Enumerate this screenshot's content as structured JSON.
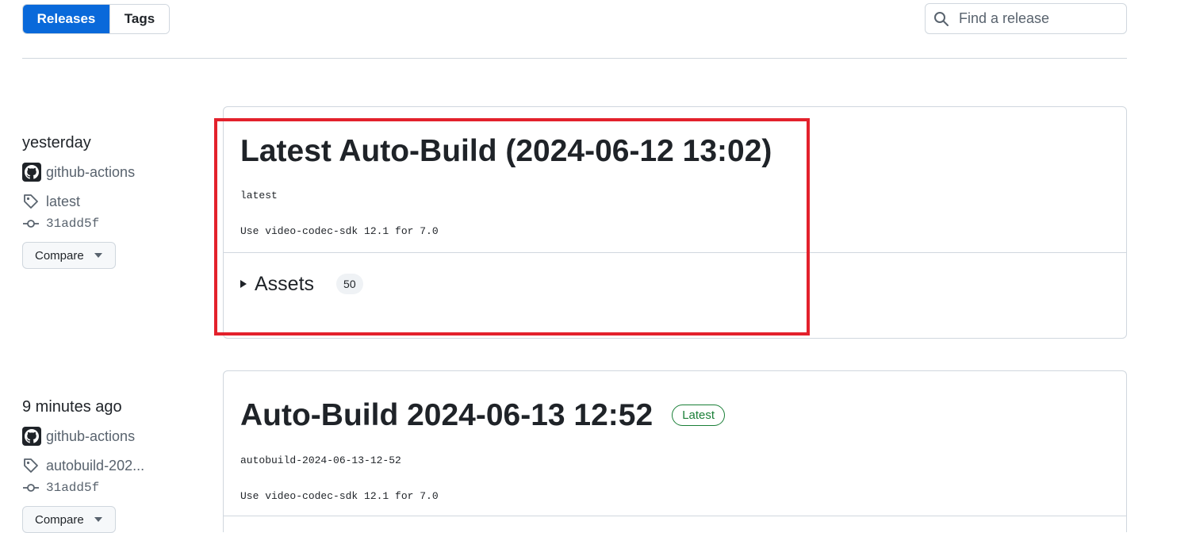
{
  "tabs": {
    "releases": "Releases",
    "tags": "Tags"
  },
  "search": {
    "placeholder": "Find a release",
    "value": ""
  },
  "releases": [
    {
      "time": "yesterday",
      "author": "github-actions",
      "tag": "latest",
      "commit": "31add5f",
      "compare_label": "Compare",
      "title": "Latest Auto-Build (2024-06-12 13:02)",
      "tag_line": "latest",
      "description": "Use video-codec-sdk 12.1 for 7.0",
      "assets_label": "Assets",
      "assets_count": "50"
    },
    {
      "time": "9 minutes ago",
      "author": "github-actions",
      "tag": "autobuild-202...",
      "commit": "31add5f",
      "compare_label": "Compare",
      "title": "Auto-Build 2024-06-13 12:52",
      "badge": "Latest",
      "tag_line": "autobuild-2024-06-13-12-52",
      "description": "Use video-codec-sdk 12.1 for 7.0"
    }
  ],
  "colors": {
    "accent": "#0969da",
    "highlight": "#e3212c",
    "latest_badge": "#1a7f37"
  },
  "icons": {
    "search": "search-icon",
    "tag": "tag-icon",
    "commit": "git-commit-icon",
    "avatar": "github-avatar-icon",
    "caret": "caret-down-icon",
    "disclosure": "disclosure-triangle-icon"
  }
}
